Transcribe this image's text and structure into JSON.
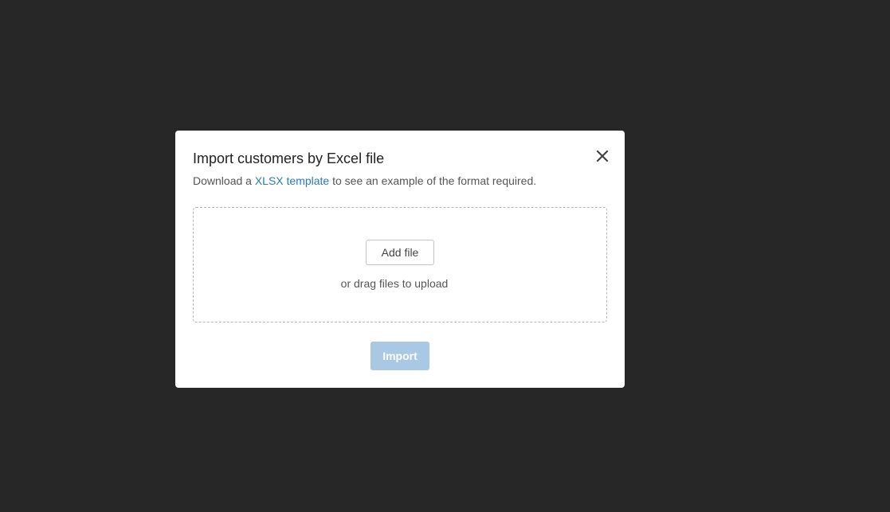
{
  "modal": {
    "title": "Import customers by Excel file",
    "subtitle_prefix": "Download a ",
    "subtitle_link": "XLSX template",
    "subtitle_suffix": " to see an example of the format required.",
    "close_icon": "close-icon",
    "dropzone": {
      "add_file_label": "Add file",
      "drag_text": "or drag files to upload"
    },
    "import_label": "Import"
  },
  "colors": {
    "backdrop": "#272727",
    "link": "#2a7ab8",
    "import_disabled": "#a9c8e4"
  }
}
